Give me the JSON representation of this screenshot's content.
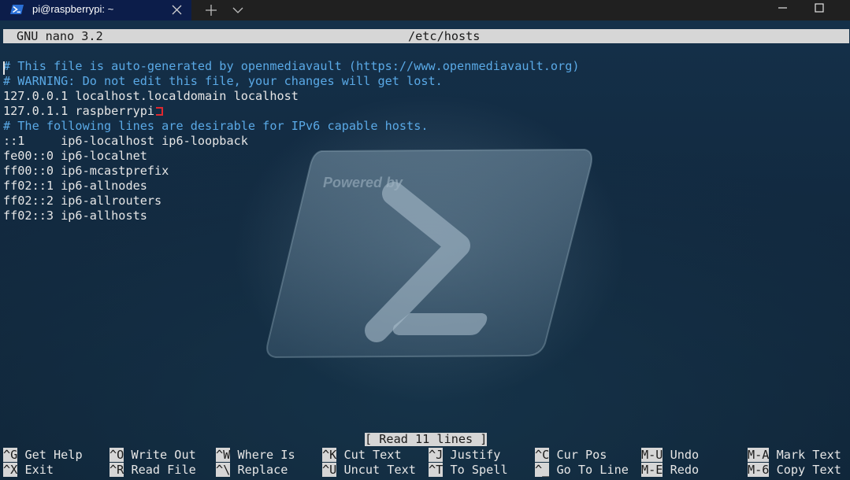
{
  "window": {
    "tab_title": "pi@raspberrypi: ~",
    "tab_icon": "powershell-icon",
    "new_tab_icon": "plus-icon",
    "dropdown_icon": "chevron-down-icon",
    "minimize_icon": "minimize-icon",
    "maximize_icon": "maximize-icon"
  },
  "nano": {
    "version": "GNU nano 3.2",
    "filename": "/etc/hosts",
    "status": "[ Read 11 lines ]"
  },
  "file_lines": [
    "# This file is auto-generated by openmediavault (https://www.openmediavault.org)",
    "# WARNING: Do not edit this file, your changes will get lost.",
    "127.0.0.1 localhost.localdomain localhost",
    "127.0.1.1 raspberrypi",
    "# The following lines are desirable for IPv6 capable hosts.",
    "::1     ip6-localhost ip6-loopback",
    "fe00::0 ip6-localnet",
    "ff00::0 ip6-mcastprefix",
    "ff02::1 ip6-allnodes",
    "ff02::2 ip6-allrouters",
    "ff02::3 ip6-allhosts"
  ],
  "watermark_text": "Powered by",
  "shortcuts": [
    {
      "key": "^G",
      "label": " Get Help"
    },
    {
      "key": "^O",
      "label": " Write Out"
    },
    {
      "key": "^W",
      "label": " Where Is"
    },
    {
      "key": "^K",
      "label": " Cut Text"
    },
    {
      "key": "^J",
      "label": " Justify"
    },
    {
      "key": "^C",
      "label": " Cur Pos"
    },
    {
      "key": "M-U",
      "label": " Undo"
    },
    {
      "key": "M-A",
      "label": " Mark Text"
    },
    {
      "key": "^X",
      "label": " Exit"
    },
    {
      "key": "^R",
      "label": " Read File"
    },
    {
      "key": "^\\",
      "label": " Replace"
    },
    {
      "key": "^U",
      "label": " Uncut Text"
    },
    {
      "key": "^T",
      "label": " To Spell"
    },
    {
      "key": "^_",
      "label": " Go To Line"
    },
    {
      "key": "M-E",
      "label": " Redo"
    },
    {
      "key": "M-6",
      "label": " Copy Text"
    }
  ],
  "colors": {
    "comment": "#5aa9e6",
    "text": "#e6e6e6",
    "bar_bg": "#d6d6d6",
    "tab_bg": "#0c1d4a",
    "titlebar_bg": "#202020",
    "cursor_mark": "#e0282f"
  }
}
